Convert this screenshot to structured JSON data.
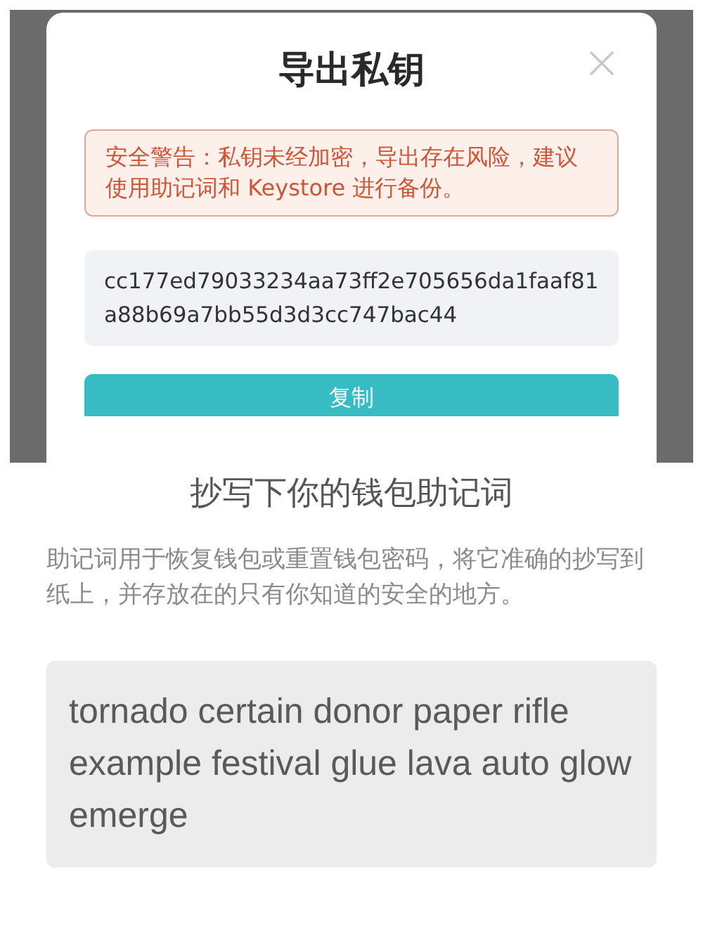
{
  "dialog": {
    "title": "导出私钥",
    "warning": "安全警告：私钥未经加密，导出存在风险，建议使用助记词和 Keystore 进行备份。",
    "private_key": "cc177ed79033234aa73ff2e705656da1faaf81a88b69a7bb55d3d3cc747bac44",
    "button": "复制"
  },
  "backup": {
    "title": "抄写下你的钱包助记词",
    "description": "助记词用于恢复钱包或重置钱包密码，将它准确的抄写到纸上，并存放在的只有你知道的安全的地方。",
    "mnemonic": "tornado certain donor paper rifle example festival glue lava auto glow emerge"
  }
}
